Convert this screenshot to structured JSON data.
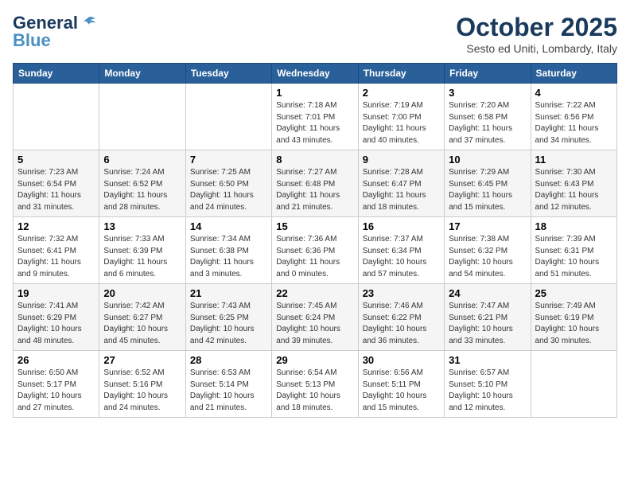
{
  "logo": {
    "general": "General",
    "blue": "Blue"
  },
  "header": {
    "month": "October 2025",
    "location": "Sesto ed Uniti, Lombardy, Italy"
  },
  "days_of_week": [
    "Sunday",
    "Monday",
    "Tuesday",
    "Wednesday",
    "Thursday",
    "Friday",
    "Saturday"
  ],
  "weeks": [
    [
      {
        "day": "",
        "info": ""
      },
      {
        "day": "",
        "info": ""
      },
      {
        "day": "",
        "info": ""
      },
      {
        "day": "1",
        "info": "Sunrise: 7:18 AM\nSunset: 7:01 PM\nDaylight: 11 hours and 43 minutes."
      },
      {
        "day": "2",
        "info": "Sunrise: 7:19 AM\nSunset: 7:00 PM\nDaylight: 11 hours and 40 minutes."
      },
      {
        "day": "3",
        "info": "Sunrise: 7:20 AM\nSunset: 6:58 PM\nDaylight: 11 hours and 37 minutes."
      },
      {
        "day": "4",
        "info": "Sunrise: 7:22 AM\nSunset: 6:56 PM\nDaylight: 11 hours and 34 minutes."
      }
    ],
    [
      {
        "day": "5",
        "info": "Sunrise: 7:23 AM\nSunset: 6:54 PM\nDaylight: 11 hours and 31 minutes."
      },
      {
        "day": "6",
        "info": "Sunrise: 7:24 AM\nSunset: 6:52 PM\nDaylight: 11 hours and 28 minutes."
      },
      {
        "day": "7",
        "info": "Sunrise: 7:25 AM\nSunset: 6:50 PM\nDaylight: 11 hours and 24 minutes."
      },
      {
        "day": "8",
        "info": "Sunrise: 7:27 AM\nSunset: 6:48 PM\nDaylight: 11 hours and 21 minutes."
      },
      {
        "day": "9",
        "info": "Sunrise: 7:28 AM\nSunset: 6:47 PM\nDaylight: 11 hours and 18 minutes."
      },
      {
        "day": "10",
        "info": "Sunrise: 7:29 AM\nSunset: 6:45 PM\nDaylight: 11 hours and 15 minutes."
      },
      {
        "day": "11",
        "info": "Sunrise: 7:30 AM\nSunset: 6:43 PM\nDaylight: 11 hours and 12 minutes."
      }
    ],
    [
      {
        "day": "12",
        "info": "Sunrise: 7:32 AM\nSunset: 6:41 PM\nDaylight: 11 hours and 9 minutes."
      },
      {
        "day": "13",
        "info": "Sunrise: 7:33 AM\nSunset: 6:39 PM\nDaylight: 11 hours and 6 minutes."
      },
      {
        "day": "14",
        "info": "Sunrise: 7:34 AM\nSunset: 6:38 PM\nDaylight: 11 hours and 3 minutes."
      },
      {
        "day": "15",
        "info": "Sunrise: 7:36 AM\nSunset: 6:36 PM\nDaylight: 11 hours and 0 minutes."
      },
      {
        "day": "16",
        "info": "Sunrise: 7:37 AM\nSunset: 6:34 PM\nDaylight: 10 hours and 57 minutes."
      },
      {
        "day": "17",
        "info": "Sunrise: 7:38 AM\nSunset: 6:32 PM\nDaylight: 10 hours and 54 minutes."
      },
      {
        "day": "18",
        "info": "Sunrise: 7:39 AM\nSunset: 6:31 PM\nDaylight: 10 hours and 51 minutes."
      }
    ],
    [
      {
        "day": "19",
        "info": "Sunrise: 7:41 AM\nSunset: 6:29 PM\nDaylight: 10 hours and 48 minutes."
      },
      {
        "day": "20",
        "info": "Sunrise: 7:42 AM\nSunset: 6:27 PM\nDaylight: 10 hours and 45 minutes."
      },
      {
        "day": "21",
        "info": "Sunrise: 7:43 AM\nSunset: 6:25 PM\nDaylight: 10 hours and 42 minutes."
      },
      {
        "day": "22",
        "info": "Sunrise: 7:45 AM\nSunset: 6:24 PM\nDaylight: 10 hours and 39 minutes."
      },
      {
        "day": "23",
        "info": "Sunrise: 7:46 AM\nSunset: 6:22 PM\nDaylight: 10 hours and 36 minutes."
      },
      {
        "day": "24",
        "info": "Sunrise: 7:47 AM\nSunset: 6:21 PM\nDaylight: 10 hours and 33 minutes."
      },
      {
        "day": "25",
        "info": "Sunrise: 7:49 AM\nSunset: 6:19 PM\nDaylight: 10 hours and 30 minutes."
      }
    ],
    [
      {
        "day": "26",
        "info": "Sunrise: 6:50 AM\nSunset: 5:17 PM\nDaylight: 10 hours and 27 minutes."
      },
      {
        "day": "27",
        "info": "Sunrise: 6:52 AM\nSunset: 5:16 PM\nDaylight: 10 hours and 24 minutes."
      },
      {
        "day": "28",
        "info": "Sunrise: 6:53 AM\nSunset: 5:14 PM\nDaylight: 10 hours and 21 minutes."
      },
      {
        "day": "29",
        "info": "Sunrise: 6:54 AM\nSunset: 5:13 PM\nDaylight: 10 hours and 18 minutes."
      },
      {
        "day": "30",
        "info": "Sunrise: 6:56 AM\nSunset: 5:11 PM\nDaylight: 10 hours and 15 minutes."
      },
      {
        "day": "31",
        "info": "Sunrise: 6:57 AM\nSunset: 5:10 PM\nDaylight: 10 hours and 12 minutes."
      },
      {
        "day": "",
        "info": ""
      }
    ]
  ]
}
